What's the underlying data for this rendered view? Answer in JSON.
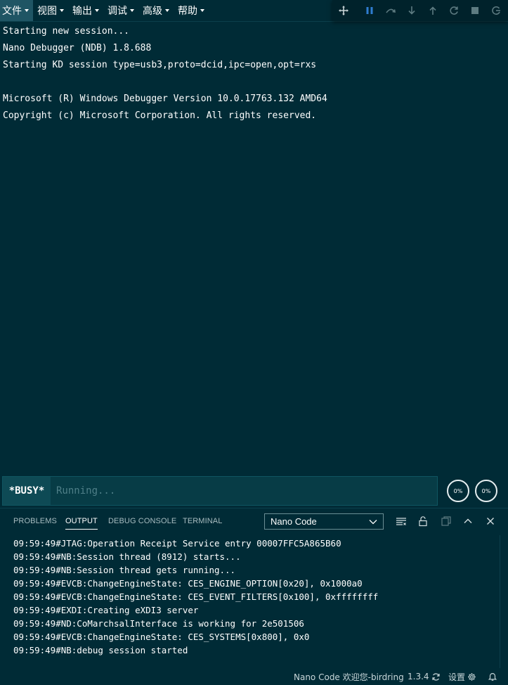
{
  "menu": {
    "items": [
      {
        "label": "文件"
      },
      {
        "label": "视图"
      },
      {
        "label": "输出"
      },
      {
        "label": "调试"
      },
      {
        "label": "高级"
      },
      {
        "label": "帮助"
      }
    ]
  },
  "debug_toolbar": {
    "icons": [
      "move-icon",
      "pause-icon",
      "step-over-icon",
      "step-into-icon",
      "step-out-icon",
      "restart-icon",
      "stop-icon",
      "disconnect-icon"
    ],
    "pause_color": "#2f7dd1"
  },
  "console": {
    "lines": [
      "Starting new session...",
      "Nano Debugger (NDB) 1.8.688",
      "Starting KD session type=usb3,proto=dcid,ipc=open,opt=rxs",
      "",
      "Microsoft (R) Windows Debugger Version 10.0.17763.132 AMD64",
      "Copyright (c) Microsoft Corporation. All rights reserved."
    ]
  },
  "command": {
    "busy_label": "*BUSY*",
    "placeholder": "Running...",
    "gauges": [
      "0%",
      "0%"
    ]
  },
  "panel": {
    "tabs": [
      {
        "label": "PROBLEMS"
      },
      {
        "label": "OUTPUT"
      },
      {
        "label": "DEBUG CONSOLE"
      },
      {
        "label": "TERMINAL"
      }
    ],
    "active_tab": "OUTPUT",
    "channel_select": "Nano Code",
    "output_lines": [
      "09:59:49#JTAG:Operation Receipt Service entry 00007FFC5A865B60",
      "09:59:49#NB:Session thread (8912) starts...",
      "09:59:49#NB:Session thread gets running...",
      "09:59:49#EVCB:ChangeEngineState: CES_ENGINE_OPTION[0x20], 0x1000a0",
      "09:59:49#EVCB:ChangeEngineState: CES_EVENT_FILTERS[0x100], 0xffffffff",
      "09:59:49#EXDI:Creating eXDI3 server",
      "09:59:49#ND:CoMarchsalInterface is working for 2e501506",
      "09:59:49#EVCB:ChangeEngineState: CES_SYSTEMS[0x800], 0x0",
      "09:59:49#NB:debug session started"
    ]
  },
  "status": {
    "welcome": "Nano Code 欢迎您-birdring",
    "version": "1.3.4",
    "settings": "设置"
  }
}
